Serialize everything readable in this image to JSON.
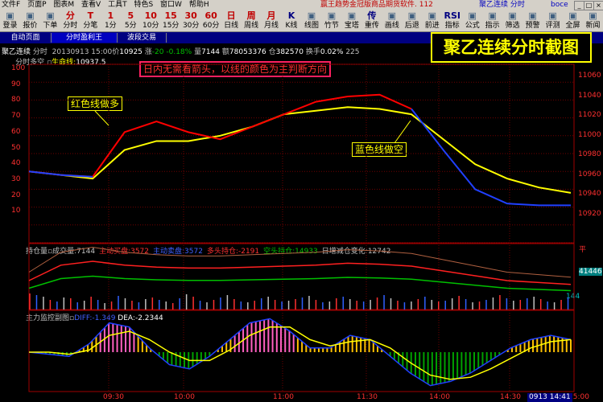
{
  "menu": {
    "items": [
      "文件F",
      "页面P",
      "图表M",
      "查看V",
      "工具T",
      "特色S",
      "窗口W",
      "帮助H"
    ],
    "window_title": "赢王趋势金冠版商品期货软件. 112",
    "instrument_tag": "聚乙连续 分时",
    "user": "boce"
  },
  "toolbar": {
    "buttons": [
      {
        "g": "",
        "l": "登录",
        "icon": "login-icon"
      },
      {
        "g": "",
        "l": "报价",
        "icon": "quote-icon"
      },
      {
        "g": "",
        "l": "下单",
        "icon": "order-icon"
      },
      {
        "g": "分",
        "l": "分时"
      },
      {
        "g": "T",
        "l": "分笔"
      },
      {
        "g": "1",
        "l": "1分"
      },
      {
        "g": "5",
        "l": "5分"
      },
      {
        "g": "10",
        "l": "10分"
      },
      {
        "g": "15",
        "l": "15分"
      },
      {
        "g": "30",
        "l": "30分"
      },
      {
        "g": "60",
        "l": "60分"
      },
      {
        "g": "日",
        "l": "日线"
      },
      {
        "g": "周",
        "l": "周线"
      },
      {
        "g": "月",
        "l": "月线"
      },
      {
        "g": "K",
        "l": "K线"
      },
      {
        "g": "",
        "l": "线图",
        "icon": "line-chart-icon"
      },
      {
        "g": "",
        "l": "竹节",
        "icon": "bamboo-icon"
      },
      {
        "g": "",
        "l": "宝塔",
        "icon": "tower-icon"
      },
      {
        "g": "传",
        "l": "重传"
      },
      {
        "g": "",
        "l": "画线",
        "icon": "draw-line-icon"
      },
      {
        "g": "",
        "l": "后退",
        "icon": "back-icon"
      },
      {
        "g": "",
        "l": "前进",
        "icon": "forward-icon"
      },
      {
        "g": "RSI",
        "l": "指标"
      },
      {
        "g": "",
        "l": "公式",
        "icon": "formula-icon"
      },
      {
        "g": "",
        "l": "指示",
        "icon": "indicator-icon"
      },
      {
        "g": "",
        "l": "筛选",
        "icon": "filter-icon"
      },
      {
        "g": "",
        "l": "预警",
        "icon": "alert-icon"
      },
      {
        "g": "",
        "l": "评测",
        "icon": "evaluate-icon"
      },
      {
        "g": "",
        "l": "全屏",
        "icon": "fullscreen-icon"
      },
      {
        "g": "",
        "l": "新闻",
        "icon": "news-icon"
      }
    ]
  },
  "tabs": [
    "自动页面",
    "分时盈利王",
    "波段交易"
  ],
  "big_title": "聚乙连续分时截图",
  "header": {
    "name": "聚乙连续",
    "mode": "分时",
    "date_time": "20130913 15:00",
    "price_label": "价",
    "price": "10925",
    "change_label": "涨",
    "change": "-20",
    "change_pct": "-0.18%",
    "volume_label": "量",
    "volume": "7144",
    "amount_label": "额",
    "amount": "78053376",
    "oi_label": "仓",
    "oi": "382570",
    "turnover_label": "换手",
    "turnover": "0.02%",
    "extra": "225"
  },
  "sub_header": {
    "label": "分时多空",
    "life_label": "生命线:",
    "life_value": "10937.5"
  },
  "annotations": {
    "notice": "日内无需看箭头，以线的颜色为主判断方向",
    "red_label": "红色线做多",
    "blue_label": "蓝色线做空"
  },
  "left_axis": [
    "100",
    "90",
    "80",
    "70",
    "60",
    "50",
    "40",
    "30",
    "20",
    "10"
  ],
  "right_axis": [
    "11060",
    "11040",
    "11020",
    "11000",
    "10980",
    "10960",
    "10940",
    "10920"
  ],
  "volume_panel": {
    "title": "持仓量",
    "items": [
      {
        "label": "成交量:",
        "value": "7144",
        "color": "#c0c0c0"
      },
      {
        "label": "主动买盘:",
        "value": "3572",
        "color": "#ff3030"
      },
      {
        "label": "主动卖盘:",
        "value": "3572",
        "color": "#4060ff"
      },
      {
        "label": "多头持仓:",
        "value": "-2191",
        "color": "#ff3030"
      },
      {
        "label": "空头持仓:",
        "value": "14933",
        "color": "#00c000"
      },
      {
        "label": "日增减仓变化:",
        "value": "12742",
        "color": "#c0c0c0"
      }
    ],
    "right_tag1": "平",
    "right_tag2": "41446",
    "right_tag3": "144"
  },
  "indicator_panel": {
    "title": "主力监控副图",
    "diff_label": "DIFF:",
    "diff_value": "-1.349",
    "dea_label": "DEA:",
    "dea_value": "-2.2344"
  },
  "time_axis": [
    "09:30",
    "10:00",
    "11:00",
    "11:30",
    "14:00",
    "14:30",
    "15:00"
  ],
  "status_time": "0913 14:41",
  "chart_data": {
    "type": "line",
    "x": [
      "09:00",
      "09:15",
      "09:30",
      "09:45",
      "10:00",
      "10:15",
      "10:30",
      "10:45",
      "11:00",
      "11:15",
      "11:30",
      "13:30",
      "13:45",
      "14:00",
      "14:15",
      "14:30",
      "14:45",
      "15:00"
    ],
    "series": [
      {
        "name": "多空线 (red/blue)",
        "color": "#ff0000",
        "values": [
          40,
          38,
          37,
          62,
          68,
          62,
          58,
          65,
          72,
          79,
          82,
          83,
          75,
          52,
          30,
          22,
          21,
          21
        ]
      },
      {
        "name": "生命线",
        "color": "#ffff00",
        "values": [
          40,
          38,
          36,
          52,
          57,
          57,
          60,
          65,
          72,
          74,
          76,
          75,
          72,
          58,
          44,
          36,
          31,
          28
        ]
      }
    ],
    "ylim": [
      0,
      100
    ]
  },
  "volume_data": {
    "oi_red": [
      30,
      46,
      50,
      46,
      44,
      43,
      43,
      44,
      45,
      46,
      48,
      47,
      45,
      40,
      35,
      30,
      28,
      26
    ],
    "vol": [
      20,
      18,
      16,
      12,
      10,
      15,
      14,
      9,
      11,
      16,
      12,
      8,
      10,
      17,
      14,
      11,
      9,
      13,
      15,
      12,
      10,
      8,
      14,
      19,
      16,
      11,
      9,
      12,
      15,
      18,
      13,
      10,
      9,
      11,
      14,
      16,
      12,
      10,
      11,
      13,
      15,
      17,
      12,
      9,
      10,
      14,
      16,
      13,
      11,
      10,
      12,
      15,
      18,
      14,
      11,
      9,
      10,
      13,
      16,
      12,
      10,
      11,
      14,
      17,
      13,
      9,
      10,
      12,
      15,
      18,
      14,
      11,
      12,
      14,
      16,
      13,
      10,
      9,
      12,
      15
    ]
  },
  "indicator_data": {
    "diff": [
      0,
      -1,
      -2,
      4,
      14,
      12,
      2,
      -6,
      -8,
      -2,
      6,
      14,
      16,
      10,
      2,
      2,
      8,
      6,
      -2,
      -10,
      -16,
      -14,
      -10,
      -4,
      2,
      6,
      8,
      6
    ],
    "dea": [
      0,
      0,
      -1,
      1,
      8,
      10,
      6,
      0,
      -4,
      -4,
      1,
      8,
      12,
      12,
      6,
      3,
      5,
      6,
      2,
      -5,
      -11,
      -13,
      -12,
      -8,
      -3,
      2,
      5,
      6
    ]
  }
}
